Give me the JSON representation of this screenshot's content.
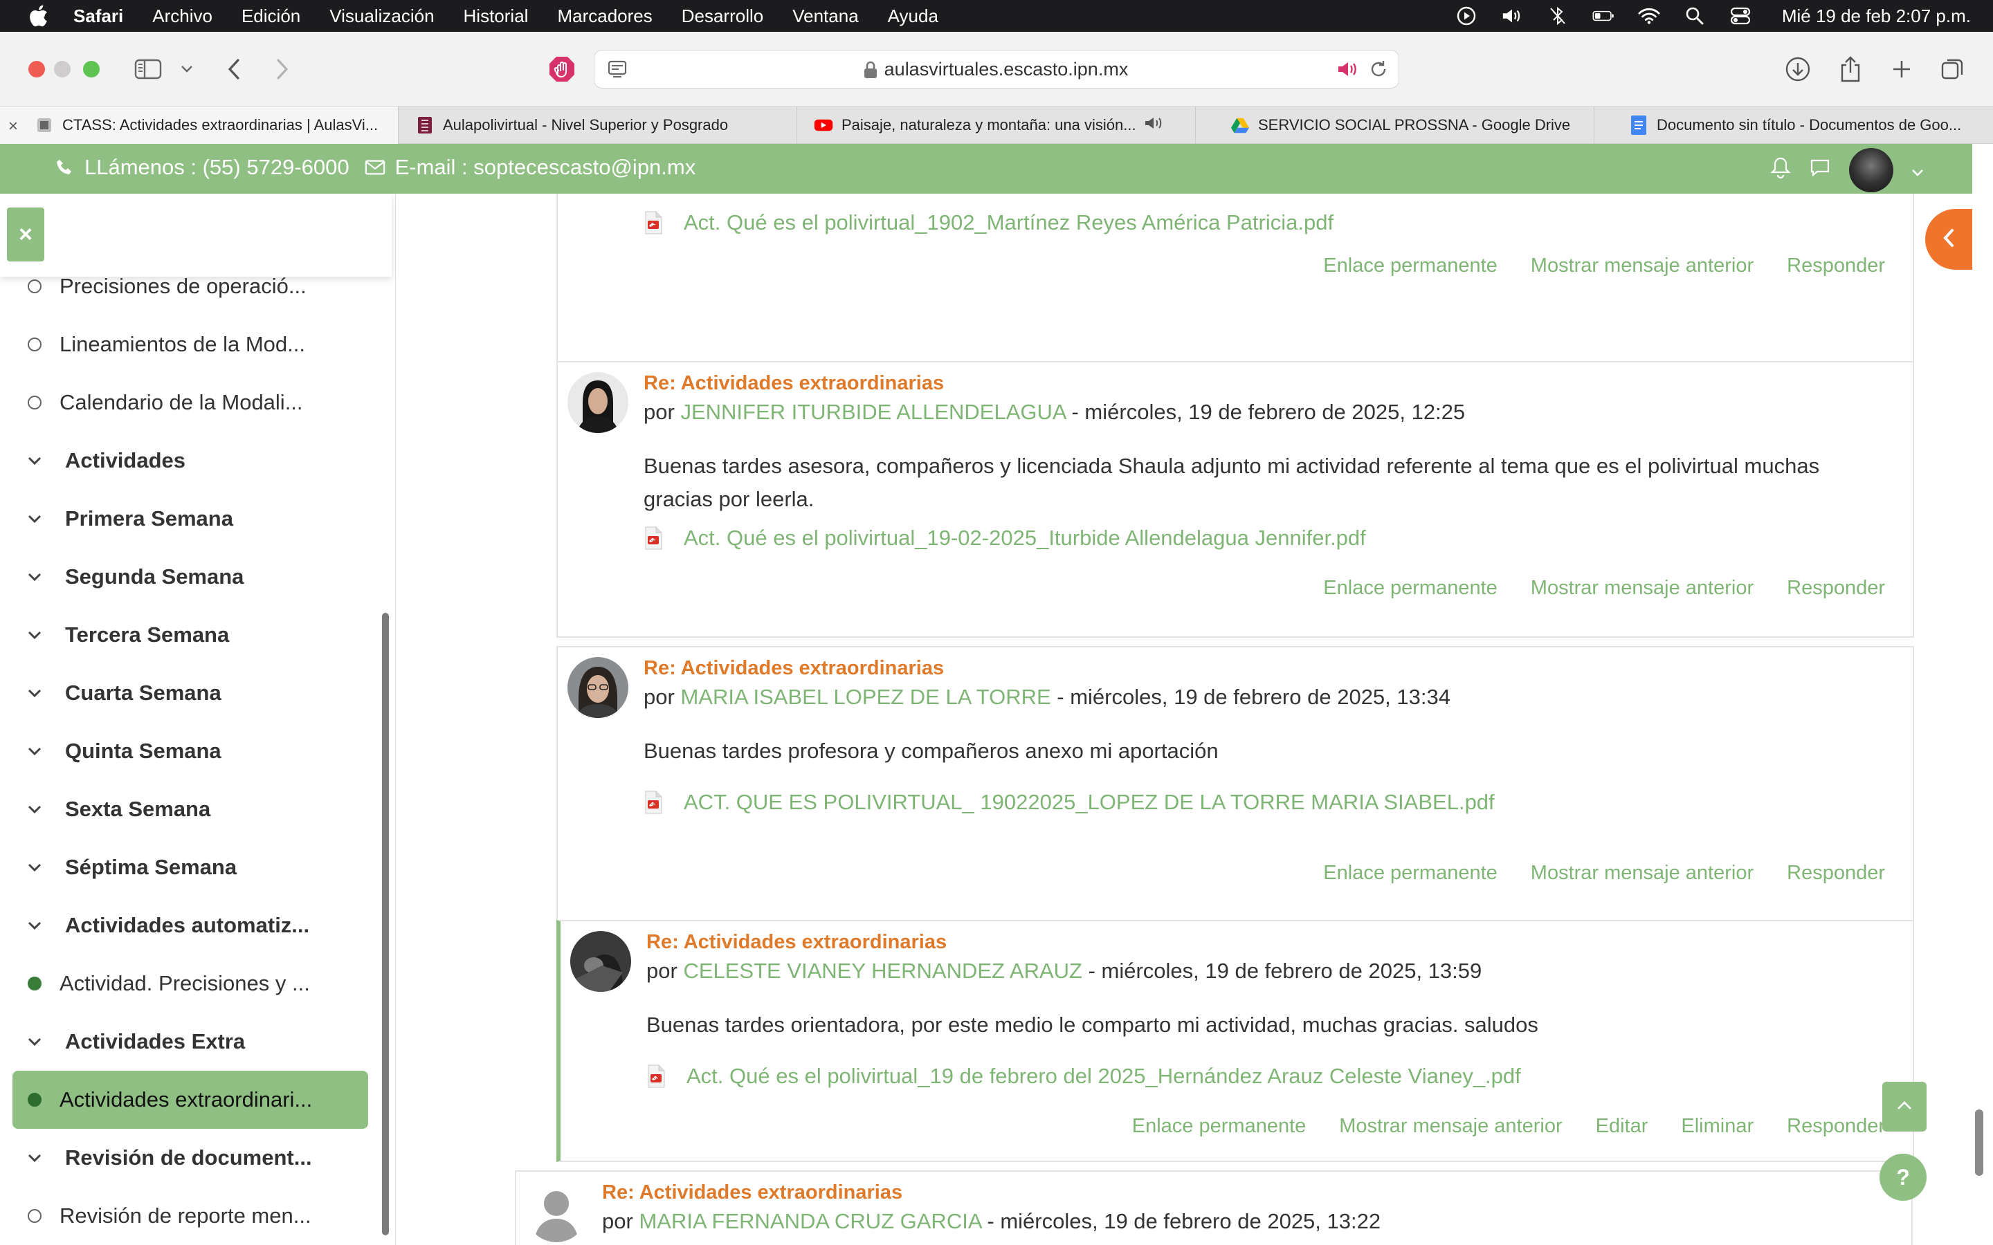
{
  "menubar": {
    "app": "Safari",
    "items": [
      "Archivo",
      "Edición",
      "Visualización",
      "Historial",
      "Marcadores",
      "Desarrollo",
      "Ventana",
      "Ayuda"
    ],
    "clock": "Mié 19 de feb  2:07 p.m."
  },
  "toolbar": {
    "url": "aulasvirtuales.escasto.ipn.mx"
  },
  "tabs": [
    {
      "title": "CTASS: Actividades extraordinarias | AulasVi..."
    },
    {
      "title": "Aulapolivirtual - Nivel Superior y Posgrado"
    },
    {
      "title": "Paisaje, naturaleza y montaña: una visión..."
    },
    {
      "title": "SERVICIO SOCIAL PROSSNA - Google Drive"
    },
    {
      "title": "Documento sin título - Documentos de Goo..."
    }
  ],
  "header": {
    "phone": "LLámenos : (55) 5729-6000",
    "email": "E-mail : soptecescasto@ipn.mx"
  },
  "nav": {
    "items": [
      {
        "label": "Precisiones de operació...",
        "kind": "activity"
      },
      {
        "label": "Lineamientos de la Mod...",
        "kind": "activity"
      },
      {
        "label": "Calendario de la Modali...",
        "kind": "activity"
      },
      {
        "label": "Actividades",
        "kind": "section"
      },
      {
        "label": "Primera Semana",
        "kind": "section"
      },
      {
        "label": "Segunda Semana",
        "kind": "section"
      },
      {
        "label": "Tercera Semana",
        "kind": "section"
      },
      {
        "label": "Cuarta Semana",
        "kind": "section"
      },
      {
        "label": "Quinta Semana",
        "kind": "section"
      },
      {
        "label": "Sexta Semana",
        "kind": "section"
      },
      {
        "label": "Séptima Semana",
        "kind": "section"
      },
      {
        "label": "Actividades automatiz...",
        "kind": "section"
      },
      {
        "label": "Actividad. Precisiones y ...",
        "kind": "activity-done"
      },
      {
        "label": "Actividades Extra",
        "kind": "section"
      },
      {
        "label": "Actividades extraordinari...",
        "kind": "selected"
      },
      {
        "label": "Revisión de document...",
        "kind": "section"
      },
      {
        "label": "Revisión de reporte men...",
        "kind": "activity"
      }
    ]
  },
  "posts": [
    {
      "attachment": "Act. Qué es el polivirtual_1902_Martínez Reyes América Patricia.pdf",
      "actions": [
        "Enlace permanente",
        "Mostrar mensaje anterior",
        "Responder"
      ]
    },
    {
      "subject": "Re: Actividades extraordinarias",
      "by": "por",
      "author": "JENNIFER ITURBIDE ALLENDELAGUA",
      "date": " - miércoles, 19 de febrero de 2025, 12:25",
      "body": "Buenas tardes asesora, compañeros y licenciada Shaula adjunto mi actividad referente al tema que es el polivirtual muchas gracias por leerla.",
      "attachment": "Act. Qué es el polivirtual_19-02-2025_Iturbide Allendelagua Jennifer.pdf",
      "actions": [
        "Enlace permanente",
        "Mostrar mensaje anterior",
        "Responder"
      ]
    },
    {
      "subject": "Re: Actividades extraordinarias",
      "by": "por",
      "author": "MARIA ISABEL LOPEZ DE LA TORRE",
      "date": " - miércoles, 19 de febrero de 2025, 13:34",
      "body": "Buenas tardes profesora y compañeros anexo mi aportación",
      "attachment": "ACT. QUE ES POLIVIRTUAL_ 19022025_LOPEZ DE LA TORRE MARIA SIABEL.pdf",
      "actions": [
        "Enlace permanente",
        "Mostrar mensaje anterior",
        "Responder"
      ]
    },
    {
      "subject": "Re: Actividades extraordinarias",
      "by": "por",
      "author": "CELESTE VIANEY HERNANDEZ ARAUZ",
      "date": " - miércoles, 19 de febrero de 2025, 13:59",
      "body": "Buenas tardes orientadora, por este medio le comparto mi actividad, muchas gracias. saludos",
      "attachment": "Act. Qué es el polivirtual_19 de febrero del 2025_Hernández Arauz Celeste Vianey_.pdf",
      "actions": [
        "Enlace permanente",
        "Mostrar mensaje anterior",
        "Editar",
        "Eliminar",
        "Responder"
      ]
    },
    {
      "subject": "Re: Actividades extraordinarias",
      "by": "por",
      "author": "MARIA FERNANDA CRUZ GARCIA",
      "date": " - miércoles, 19 de febrero de 2025, 13:22"
    }
  ],
  "colors": {
    "brand_green": "#8fbf82",
    "link_green": "#7fb574",
    "subject_orange": "#e07a2b",
    "side_toggle_orange": "#f0742c"
  },
  "floating": {
    "help": "?"
  }
}
